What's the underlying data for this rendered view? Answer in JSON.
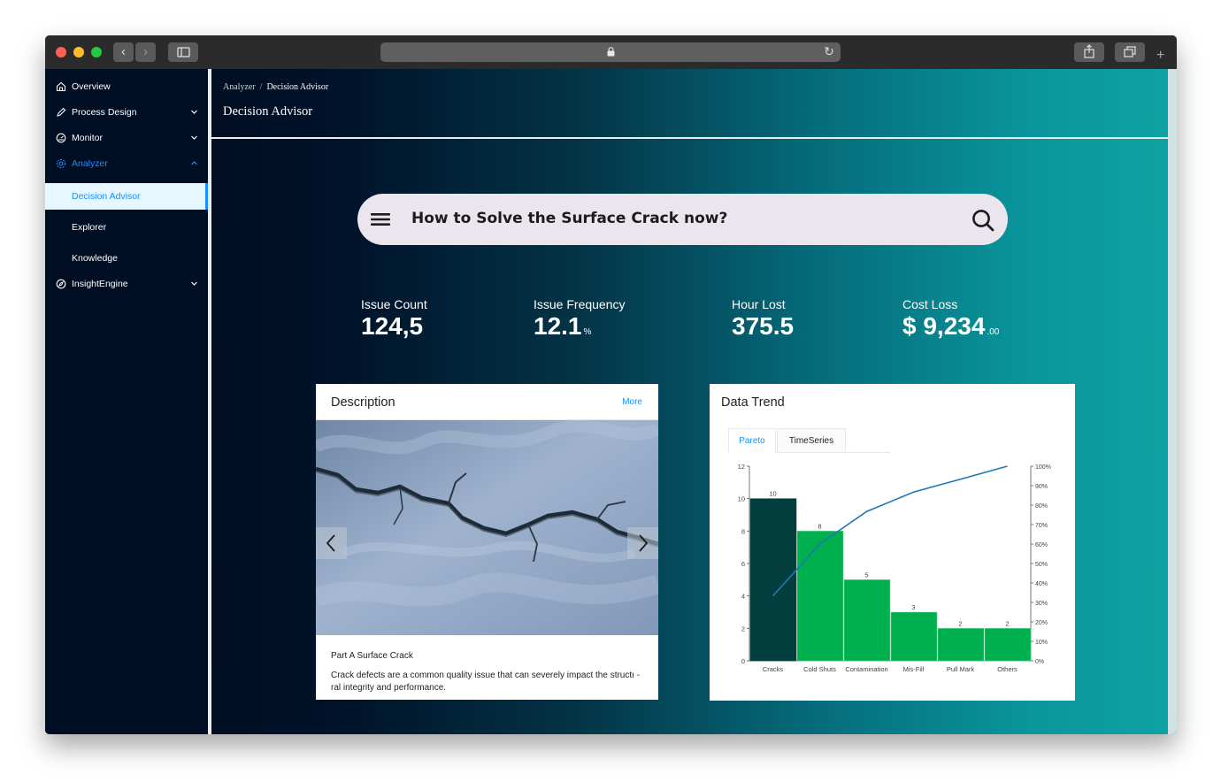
{
  "sidebar": {
    "items": [
      {
        "label": "Overview"
      },
      {
        "label": "Process Design"
      },
      {
        "label": "Monitor"
      },
      {
        "label": "Analyzer"
      },
      {
        "label": "InsightEngine"
      }
    ],
    "subitems": [
      {
        "label": "Decision Advisor"
      },
      {
        "label": "Explorer"
      },
      {
        "label": "Knowledge"
      }
    ]
  },
  "header": {
    "breadcrumb_parent": "Analyzer",
    "breadcrumb_separator": "/",
    "breadcrumb_current": "Decision Advisor",
    "title": "Decision Advisor"
  },
  "search": {
    "query": "How to Solve the Surface Crack now?"
  },
  "kpis": [
    {
      "label": "Issue Count",
      "value": "124,5",
      "unit": ""
    },
    {
      "label": "Issue Frequency",
      "value": "12.1",
      "unit": "%"
    },
    {
      "label": "Hour Lost",
      "value": "375.5",
      "unit": ""
    },
    {
      "label": "Cost Loss",
      "value": "$ 9,234",
      "unit": ".00"
    }
  ],
  "description": {
    "title": "Description",
    "more": "More",
    "caption_title": "Part A Surface Crack",
    "caption_body": "Crack defects are a common quality issue that can severely impact the structı -ral integrity and performance."
  },
  "trend": {
    "title": "Data Trend",
    "tabs": [
      {
        "label": "Pareto"
      },
      {
        "label": "TimeSeries"
      }
    ]
  },
  "colors": {
    "accent": "#1890ff",
    "first_bar": "#033e3e",
    "bars": "#00b04f",
    "line": "#1f77b4"
  },
  "chart_data": {
    "type": "bar",
    "categories": [
      "Cracks",
      "Cold Shuts",
      "Contamination",
      "Mis-Fill",
      "Pull Mark",
      "Others"
    ],
    "values": [
      10,
      8,
      5,
      3,
      2,
      2
    ],
    "value_labels": [
      "10",
      "8",
      "5",
      "3",
      "2",
      "2"
    ],
    "y_ticks": [
      "0",
      "2",
      "4",
      "6",
      "8",
      "10",
      "12"
    ],
    "ylim": [
      0,
      12
    ],
    "y2_ticks": [
      "0%",
      "10%",
      "20%",
      "30%",
      "40%",
      "50%",
      "60%",
      "70%",
      "80%",
      "90%",
      "100%"
    ],
    "y2lim": [
      0,
      100
    ],
    "cumulative_percent": [
      33.3,
      60.0,
      76.7,
      86.7,
      93.3,
      100.0
    ],
    "grid": false,
    "legend": "none"
  }
}
